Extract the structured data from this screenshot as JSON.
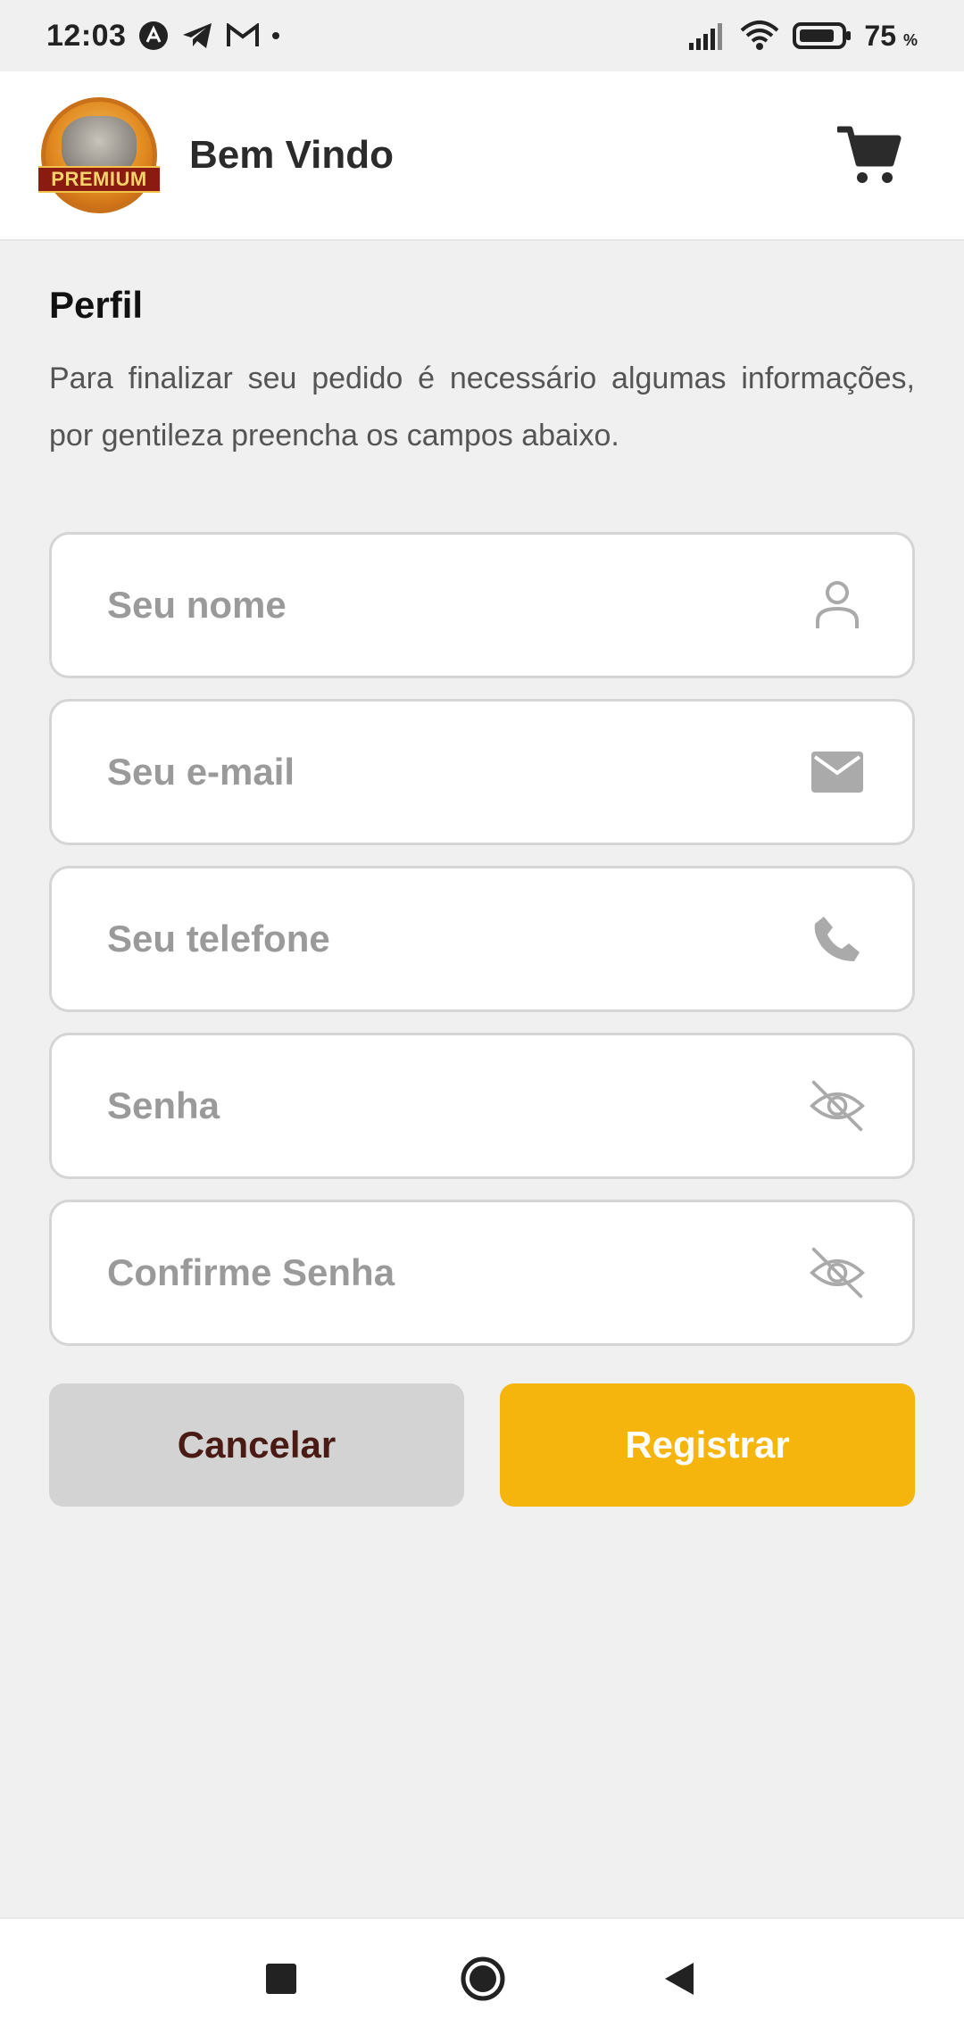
{
  "status_bar": {
    "time": "12:03",
    "battery": "75",
    "battery_unit": "%"
  },
  "app_bar": {
    "title": "Bem Vindo",
    "logo_text": "PREMIUM"
  },
  "profile": {
    "title": "Perfil",
    "description": "Para finalizar seu pedido é necessário algumas informações, por gentileza preencha os campos abaixo."
  },
  "form": {
    "name_placeholder": "Seu nome",
    "email_placeholder": "Seu e-mail",
    "phone_placeholder": "Seu telefone",
    "password_placeholder": "Senha",
    "confirm_password_placeholder": "Confirme Senha"
  },
  "actions": {
    "cancel_label": "Cancelar",
    "register_label": "Registrar"
  },
  "colors": {
    "accent": "#f6b50c",
    "cancel_bg": "#d3d3d3",
    "cancel_text": "#4a1a14"
  },
  "icons": {
    "name": "person-icon",
    "email": "mail-icon",
    "phone": "phone-icon",
    "password": "eye-off-icon",
    "cart": "cart-icon"
  }
}
